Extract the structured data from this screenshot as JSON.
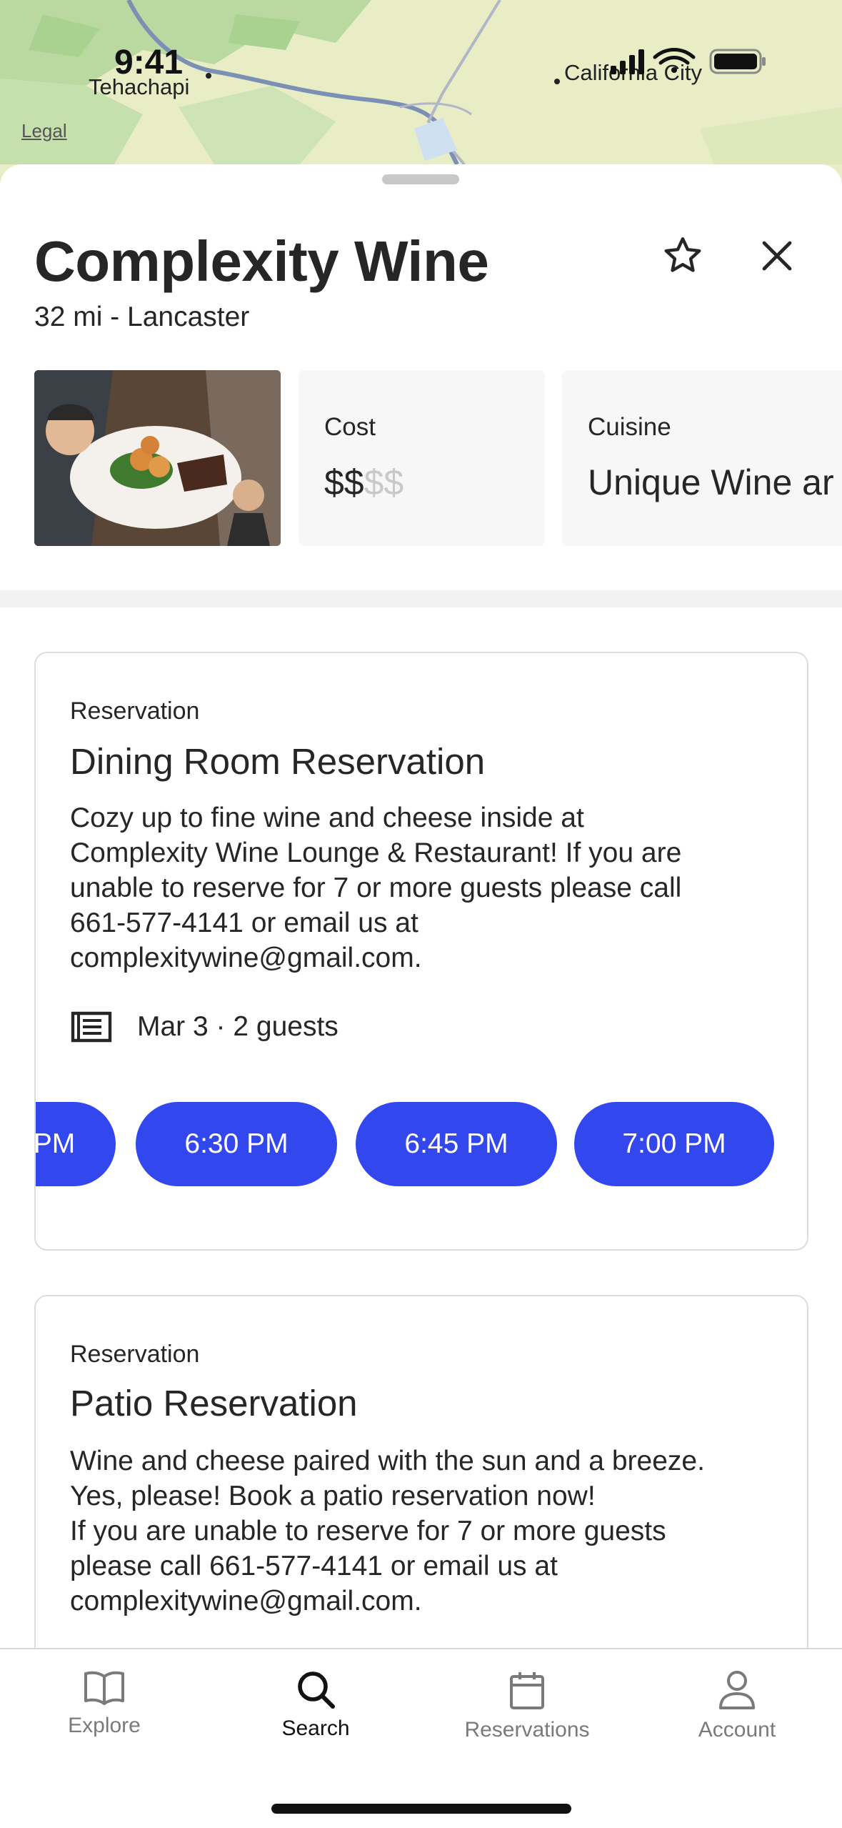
{
  "status_bar": {
    "time": "9:41"
  },
  "map": {
    "labels": {
      "town_left": "Tehachapi",
      "town_right": "California City"
    },
    "legal": "Legal"
  },
  "restaurant": {
    "name": "Complexity Wine",
    "distance_location": "32 mi - Lancaster"
  },
  "info_cards": {
    "cost": {
      "label": "Cost",
      "value_active": "$$",
      "value_dim": "$$"
    },
    "cuisine": {
      "label": "Cuisine",
      "value": "Unique Wine ar"
    }
  },
  "reservations": [
    {
      "kicker": "Reservation",
      "title": "Dining Room Reservation",
      "description": "Cozy up to fine wine and cheese inside at\nComplexity Wine Lounge & Restaurant! If you are\nunable to reserve for 7 or more guests please call\n661-577-4141 or email us at\ncomplexitywine@gmail.com.",
      "meta": "Mar 3 · 2 guests",
      "slots": [
        "PM",
        "6:30 PM",
        "6:45 PM",
        "7:00 PM"
      ]
    },
    {
      "kicker": "Reservation",
      "title": "Patio Reservation",
      "description": "Wine and cheese paired with the sun and a breeze.\nYes, please! Book a patio reservation now!\nIf you are unable to reserve for 7 or more guests\nplease call 661-577-4141 or email us at\ncomplexitywine@gmail.com."
    }
  ],
  "tabbar": {
    "items": [
      {
        "label": "Explore",
        "icon": "book-icon"
      },
      {
        "label": "Search",
        "icon": "search-icon"
      },
      {
        "label": "Reservations",
        "icon": "calendar-icon"
      },
      {
        "label": "Account",
        "icon": "person-icon"
      }
    ],
    "active": "Search"
  },
  "colors": {
    "accent": "#3347ee",
    "text": "#262626",
    "muted": "#7a7a7a"
  }
}
